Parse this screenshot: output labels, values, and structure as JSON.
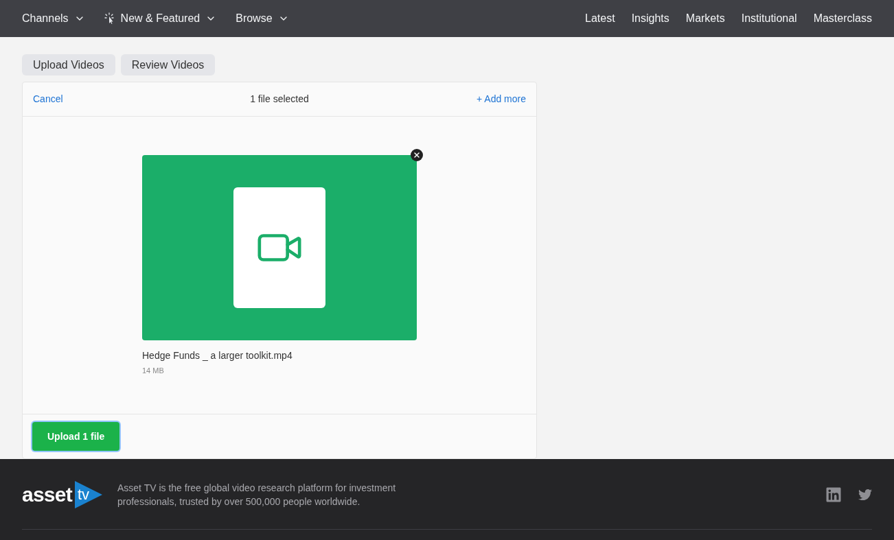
{
  "nav": {
    "left": [
      {
        "label": "Channels",
        "kind": "plain"
      },
      {
        "label": "New & Featured",
        "kind": "featured"
      },
      {
        "label": "Browse",
        "kind": "plain"
      }
    ],
    "right": [
      "Latest",
      "Insights",
      "Markets",
      "Institutional",
      "Masterclass"
    ]
  },
  "tabs": [
    {
      "label": "Upload Videos",
      "selected": false
    },
    {
      "label": "Review Videos",
      "selected": false
    }
  ],
  "uploader": {
    "cancel": "Cancel",
    "status": "1 file selected",
    "add_more": "+ Add more",
    "files": [
      {
        "name": "Hedge Funds _ a larger toolkit.mp4",
        "size": "14 MB"
      }
    ],
    "upload_button": "Upload 1 file"
  },
  "footer": {
    "logo": {
      "word": "asset",
      "badge": "tv"
    },
    "tagline": "Asset TV is the free global video research platform for investment professionals, trusted by over 500,000 people worldwide."
  }
}
